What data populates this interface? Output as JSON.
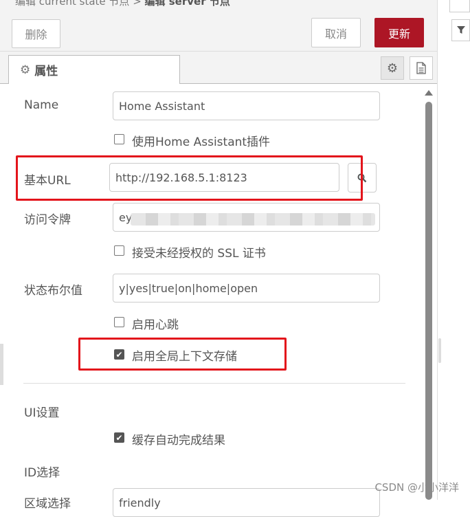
{
  "header": {
    "breadcrumb_left": "编辑 current state 节点",
    "breadcrumb_sep": " > ",
    "breadcrumb_right": "编辑 server 节点"
  },
  "toolbar": {
    "delete_label": "删除",
    "cancel_label": "取消",
    "update_label": "更新"
  },
  "tabs": {
    "properties_label": "属性"
  },
  "form": {
    "name": {
      "label": "Name",
      "value": "Home Assistant"
    },
    "use_addon": {
      "label": "使用Home Assistant插件",
      "checked": false
    },
    "base_url": {
      "label": "基本URL",
      "value": "http://192.168.5.1:8123"
    },
    "access_token": {
      "label": "访问令牌",
      "value": "ey"
    },
    "accept_unauthorized_ssl": {
      "label": "接受未经授权的 SSL 证书",
      "checked": false
    },
    "state_boolean": {
      "label": "状态布尔值",
      "value": "y|yes|true|on|home|open"
    },
    "heartbeat": {
      "label": "启用心跳",
      "checked": false
    },
    "global_context": {
      "label": "启用全局上下文存储",
      "checked": true
    },
    "ui_settings_heading": "UI设置",
    "cache_autocomplete": {
      "label": "缓存自动完成结果",
      "checked": true
    },
    "id_selection_heading": "ID选择",
    "entity_selection": {
      "label": "区域选择",
      "value": "friendly"
    }
  },
  "colors": {
    "primary": "#ad1625",
    "highlight": "#e3141b"
  },
  "watermark": "CSDN @小小洋洋"
}
